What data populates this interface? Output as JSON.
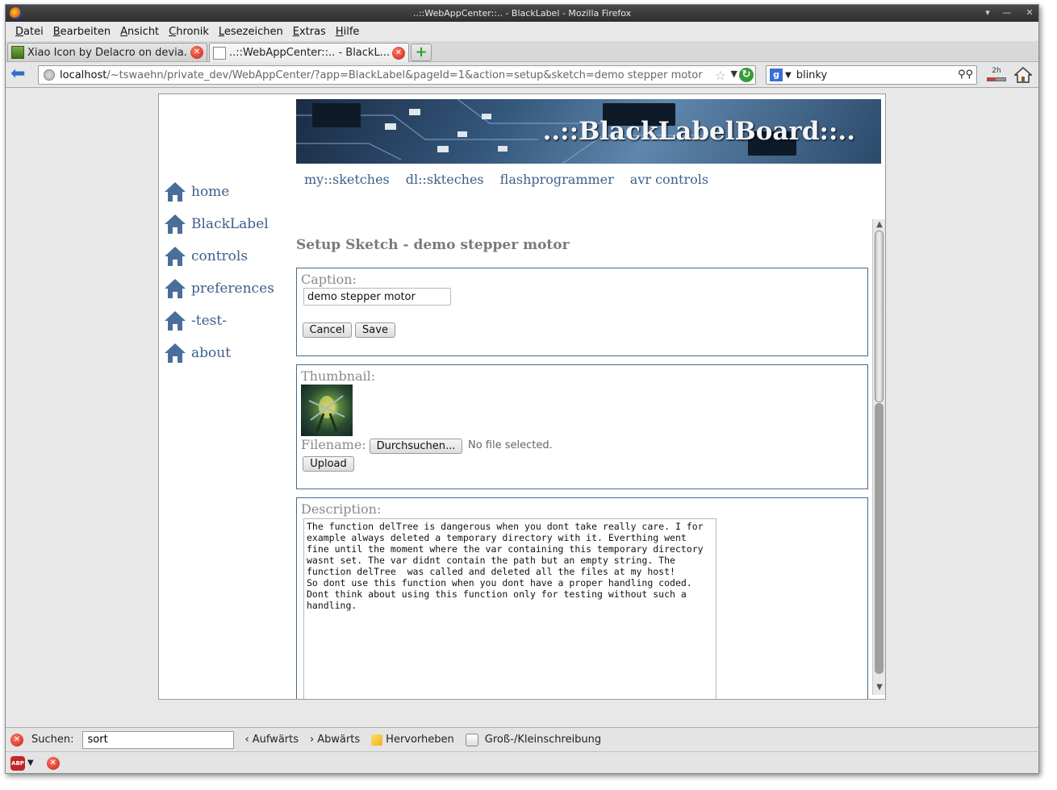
{
  "window": {
    "title": "..::WebAppCenter::.. - BlackLabel - Mozilla Firefox",
    "controls": [
      "▾",
      "—",
      "—",
      "✕"
    ]
  },
  "menubar": {
    "items": [
      {
        "label": "Datei",
        "key": "D",
        "rest": "atei"
      },
      {
        "label": "Bearbeiten",
        "key": "B",
        "rest": "earbeiten"
      },
      {
        "label": "Ansicht",
        "key": "A",
        "rest": "nsicht"
      },
      {
        "label": "Chronik",
        "key": "C",
        "rest": "hronik"
      },
      {
        "label": "Lesezeichen",
        "key": "L",
        "rest": "esezeichen"
      },
      {
        "label": "Extras",
        "key": "E",
        "rest": "xtras"
      },
      {
        "label": "Hilfe",
        "key": "H",
        "rest": "ilfe"
      }
    ]
  },
  "tabs": [
    {
      "label": "Xiao Icon by Delacro on devia...",
      "active": false
    },
    {
      "label": "..::WebAppCenter::.. - BlackL...",
      "active": true
    }
  ],
  "newtab_label": "+",
  "navbar": {
    "url_host": "localhost",
    "url_rest": "/~tswaehn/private_dev/WebAppCenter/?app=BlackLabel&pageId=1&action=setup&sketch=demo stepper motor",
    "search_value": "blinky",
    "search_engine_label": "g",
    "timer_label": "2h",
    "timer_progress": 0.45
  },
  "sidebar": {
    "items": [
      {
        "label": "home"
      },
      {
        "label": "BlackLabel"
      },
      {
        "label": "controls"
      },
      {
        "label": "preferences"
      },
      {
        "label": "-test-"
      },
      {
        "label": "about"
      }
    ]
  },
  "banner": {
    "title": "..::BlackLabelBoard::.."
  },
  "topnav": {
    "items": [
      "my::sketches",
      "dl::sktech­es",
      "flashprogrammer",
      "avr controls"
    ]
  },
  "main": {
    "heading": "Setup Sketch - demo stepper motor",
    "caption": {
      "label": "Caption:",
      "value": "demo stepper motor",
      "cancel_label": "Cancel",
      "save_label": "Save"
    },
    "thumbnail": {
      "label": "Thumbnail:",
      "filename_label": "Filename:",
      "browse_label": "Durchsuchen...",
      "nofile_text": "No file selected.",
      "upload_label": "Upload"
    },
    "description": {
      "label": "Description:",
      "value": "The function delTree is dangerous when you dont take really care. I for\nexample always deleted a temporary directory with it. Everthing went\nfine until the moment where the var containing this temporary directory\nwasnt set. The var didnt contain the path but an empty string. The\nfunction delTree  was called and deleted all the files at my host!\nSo dont use this function when you dont have a proper handling coded.\nDont think about using this function only for testing without such a\nhandling."
    }
  },
  "findbar": {
    "label": "Suchen:",
    "value": "sort",
    "up_label": "Aufwärts",
    "down_label": "Abwärts",
    "highlight_label": "Hervorheben",
    "matchcase_label": "Groß-/Kleinschreibung"
  },
  "colors": {
    "link": "#3c5f8a",
    "fieldset_border": "#4a6a8a",
    "label_gray": "#8a8a8a"
  }
}
